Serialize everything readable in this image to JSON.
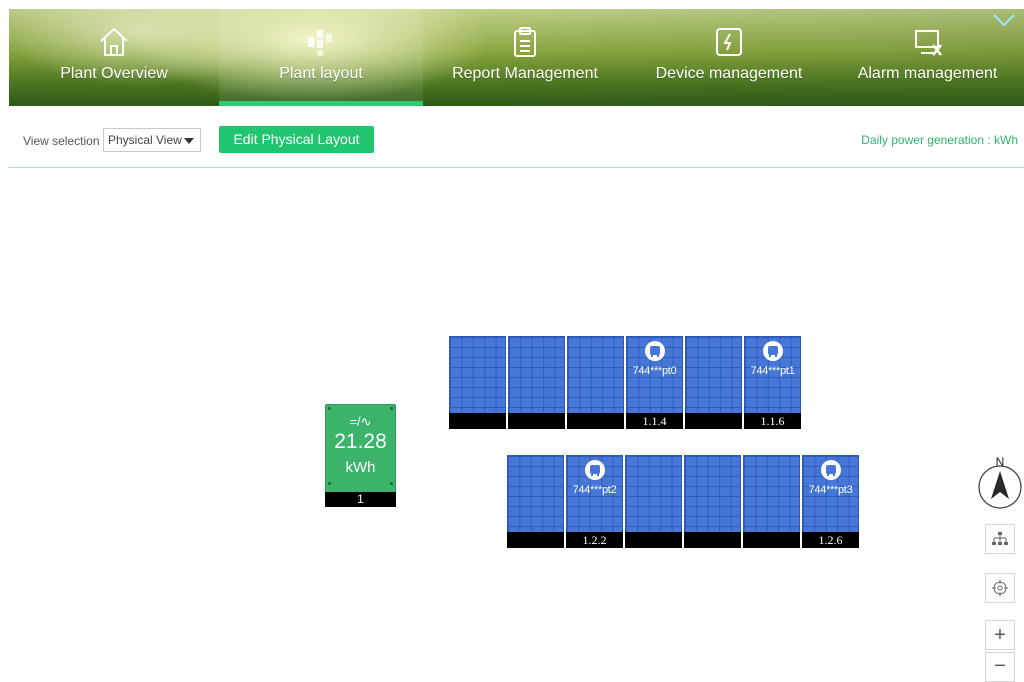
{
  "nav": {
    "items": [
      {
        "label": "Plant Overview",
        "icon": "home-icon"
      },
      {
        "label": "Plant layout",
        "icon": "layout-icon",
        "active": true
      },
      {
        "label": "Report Management",
        "icon": "clipboard-icon"
      },
      {
        "label": "Device management",
        "icon": "device-icon"
      },
      {
        "label": "Alarm management",
        "icon": "monitor-tools-icon"
      }
    ]
  },
  "toolbar": {
    "view_selection_label": "View selection",
    "view_selected": "Physical View",
    "edit_button": "Edit Physical Layout",
    "daily_generation": "Daily power generation : kWh"
  },
  "meter": {
    "symbol": "=/∿",
    "value": "21.28",
    "unit": "kWh",
    "id": "1"
  },
  "panels": {
    "row1": [
      {
        "label": ""
      },
      {
        "label": ""
      },
      {
        "label": ""
      },
      {
        "label": "1.1.4",
        "inverter": "744***pt0"
      },
      {
        "label": ""
      },
      {
        "label": "1.1.6",
        "inverter": "744***pt1"
      }
    ],
    "row2": [
      {
        "label": ""
      },
      {
        "label": "1.2.2",
        "inverter": "744***pt2"
      },
      {
        "label": ""
      },
      {
        "label": ""
      },
      {
        "label": ""
      },
      {
        "label": "1.2.6",
        "inverter": "744***pt3"
      }
    ]
  },
  "map_tools": {
    "compass_label": "N",
    "zoom_in": "+",
    "zoom_out": "−"
  },
  "colors": {
    "accent": "#21c46f",
    "panel": "#4677d6",
    "meter": "#3bb36b"
  }
}
